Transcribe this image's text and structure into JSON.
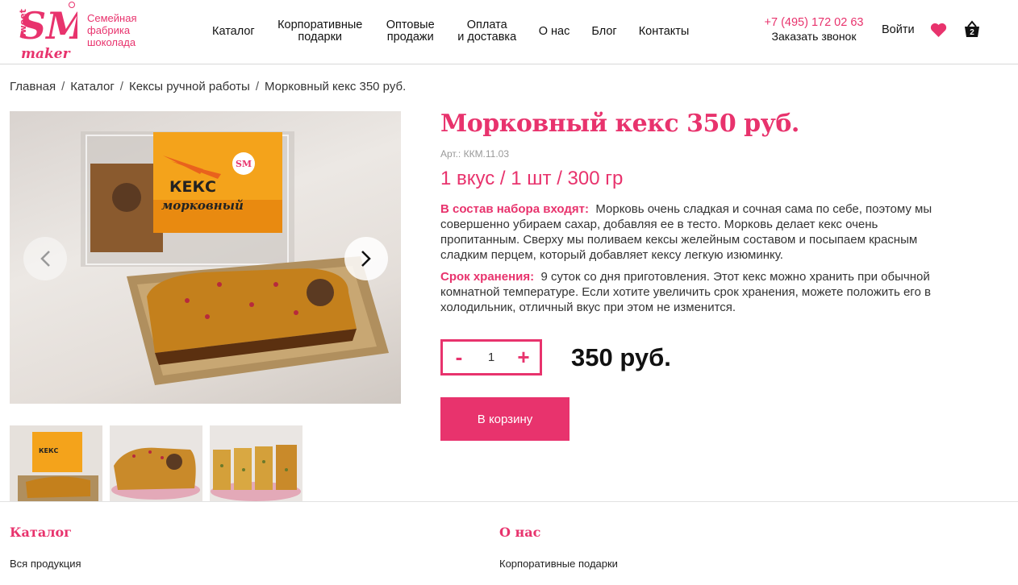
{
  "header": {
    "logo_text": "Семейная фабрика шоколада",
    "logo_mark": "SM sweet maker",
    "nav": [
      {
        "label": "Каталог"
      },
      {
        "label": "Корпоративные подарки"
      },
      {
        "label": "Оптовые продажи"
      },
      {
        "label": "Оплата и доставка"
      },
      {
        "label": "О нас"
      },
      {
        "label": "Блог"
      },
      {
        "label": "Контакты"
      }
    ],
    "phone": "+7 (495) 172 02 63",
    "callback": "Заказать звонок",
    "login": "Войти",
    "cart_count": "2",
    "icons": [
      "heart-icon",
      "cart-icon"
    ]
  },
  "breadcrumb": [
    "Главная",
    "Каталог",
    "Кексы ручной работы",
    "Морковный кекс 350 руб."
  ],
  "gallery": {
    "package_label_top": "КЕКС",
    "package_label_bottom": "морковный",
    "thumbnails": [
      "package",
      "cake-whole",
      "cake-sliced"
    ]
  },
  "product": {
    "title": "Морковный кекс 350 руб.",
    "article": "Арт.: ККМ.11.03",
    "variant": "1 вкус / 1 шт / 300 гр",
    "composition_label": "В состав набора входят:",
    "composition_text": "Морковь очень сладкая и сочная сама по себе, поэтому мы совершенно убираем сахар, добавляя ее в тесто. Морковь делает кекс очень пропитанным. Сверху мы поливаем кексы желейным составом и посыпаем красным сладким перцем, который добавляет кексу легкую изюминку.",
    "shelf_label": "Срок хранения:",
    "shelf_text": "9 суток со дня приготовления. Этот кекс можно хранить при обычной комнатной температуре. Если хотите увеличить срок хранения, можете положить его в холодильник, отличный вкус при этом не изменится.",
    "qty_minus": "-",
    "qty_plus": "+",
    "qty_value": "1",
    "price": "350 руб.",
    "buy_label": "В корзину"
  },
  "footer": {
    "catalog_title": "Каталог",
    "catalog_link": "Вся продукция",
    "about_title": "О нас",
    "about_link": "Корпоративные подарки"
  },
  "colors": {
    "accent": "#e8336d",
    "text": "#222222"
  }
}
